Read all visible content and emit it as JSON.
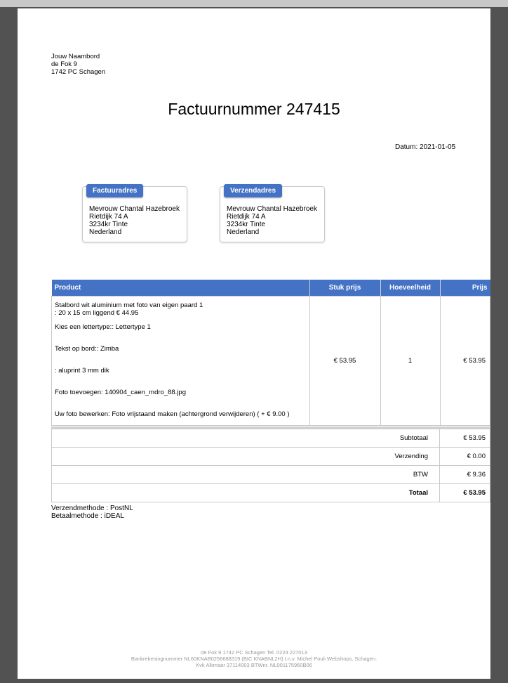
{
  "sender": {
    "line1": "Jouw Naambord",
    "line2": "de Fok 9",
    "line3": "1742 PC Schagen"
  },
  "title": "Factuurnummer 247415",
  "date": "Datum: 2021-01-05",
  "billing": {
    "tag": "Factuuradres",
    "name": "Mevrouw Chantal Hazebroek",
    "street": "Rietdijk 74 A",
    "city": "3234kr Tinte",
    "country": "Nederland"
  },
  "shipping": {
    "tag": "Verzendadres",
    "name": "Mevrouw Chantal Hazebroek",
    "street": "Rietdijk 74 A",
    "city": "3234kr Tinte",
    "country": "Nederland"
  },
  "table": {
    "headers": {
      "product": "Product",
      "unit_price": "Stuk prijs",
      "quantity": "Hoeveelheid",
      "price": "Prijs"
    },
    "item": {
      "name": "Stalbord wit aluminium met foto van eigen paard 1",
      "size": ": 20 x 15 cm liggend € 44.95",
      "font": "Kies een lettertype:: Lettertype 1",
      "text": "Tekst op bord:: Zimba",
      "material": ": aluprint 3 mm dik",
      "photo": "Foto toevoegen: 140904_caen_mdro_88.jpg",
      "edit": "Uw foto bewerken: Foto vrijstaand maken (achtergrond verwijderen) ( + € 9.00 )",
      "unit_price": "€ 53.95",
      "quantity": "1",
      "price": "€ 53.95"
    }
  },
  "totals": {
    "subtotal_label": "Subtotaal",
    "subtotal_value": "€ 53.95",
    "shipping_label": "Verzending",
    "shipping_value": "€ 0.00",
    "vat_label": "BTW",
    "vat_value": "€ 9.36",
    "total_label": "Totaal",
    "total_value": "€ 53.95"
  },
  "methods": {
    "shipping": "Verzendmethode : PostNL",
    "payment": "Betaalmethode : iDEAL"
  },
  "footer": {
    "line1": "de Fok 9 1742 PC Schagen Tel. 0224 227013",
    "line2": "Bankrekeningnummer NL60KNAB0256688319 (BIC KNABNL2H) t.n.v. Michel Pouli Webshops, Schagen.",
    "line3": "Kvk Alkmaar 37114003 BTWnr. NL001175960B06"
  }
}
